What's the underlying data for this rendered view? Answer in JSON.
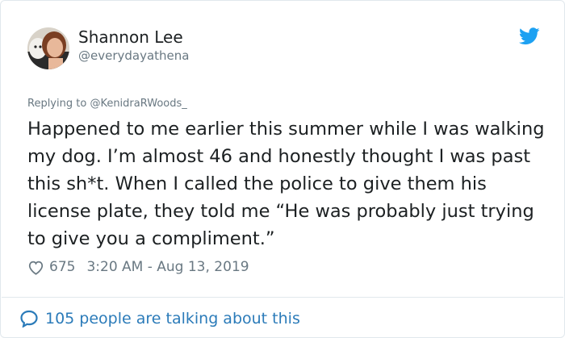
{
  "tweet": {
    "author_name": "Shannon Lee",
    "author_handle": "@everydayathena",
    "replying_prefix": "Replying to ",
    "replying_to": "@KenidraRWoods_",
    "text": "Happened to me earlier this summer while I was walking my dog. I’m almost 46 and honestly thought I was past this sh*t. When I called the police to give them his license plate, they told me “He was probably just trying to give you a compliment.”",
    "likes": "675",
    "timestamp": "3:20 AM - Aug 13, 2019"
  },
  "footer": {
    "talking_text": "105 people are talking about this"
  },
  "icons": {
    "brand": "twitter-bird-icon",
    "like": "heart-icon",
    "conversation": "speech-bubble-icon"
  },
  "colors": {
    "twitter_blue": "#1da1f2",
    "link_blue": "#2b7bb9",
    "secondary_text": "#697882",
    "primary_text": "#1c2022",
    "border": "#e1e8ed"
  }
}
